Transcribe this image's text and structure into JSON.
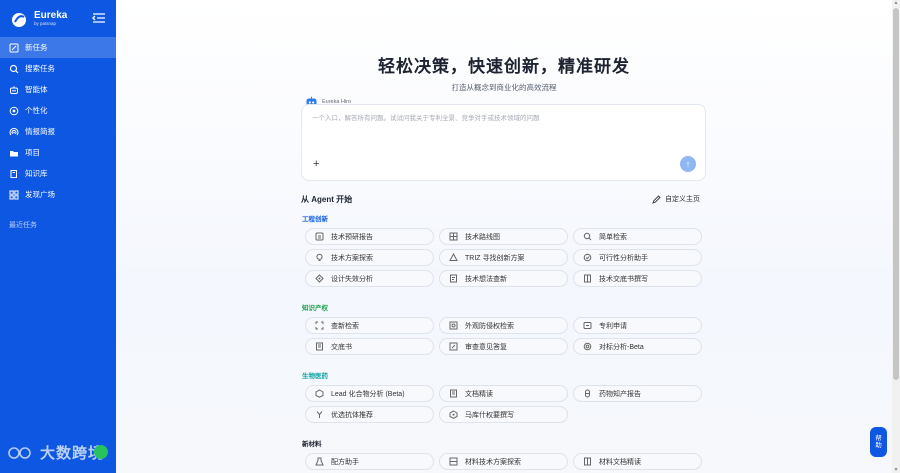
{
  "brand": {
    "name": "Eureka",
    "sub": "by patsnap"
  },
  "sidebar": {
    "items": [
      {
        "label": "新任务",
        "icon": "new-task-icon",
        "active": true
      },
      {
        "label": "搜索任务",
        "icon": "search-icon"
      },
      {
        "label": "智能体",
        "icon": "agent-icon"
      },
      {
        "label": "个性化",
        "icon": "personalize-icon"
      },
      {
        "label": "情报简报",
        "icon": "broadcast-icon"
      },
      {
        "label": "项目",
        "icon": "folder-icon"
      },
      {
        "label": "知识库",
        "icon": "book-icon"
      },
      {
        "label": "发现广场",
        "icon": "grid-icon"
      }
    ],
    "recent_label": "最近任务"
  },
  "watermark": {
    "text": "大数跨境"
  },
  "hero": {
    "title": "轻松决策，快速创新，精准研发",
    "subtitle": "打造从概念到商业化的高效流程"
  },
  "assistant": {
    "name": "Eureka Hiro"
  },
  "chat": {
    "placeholder": "一个入口，解答所有问题。试试问我关于专利全景、竞争对手或技术领域的问题",
    "add_label": "+",
    "send_label": "↑"
  },
  "agents": {
    "heading": "从 Agent 开始",
    "customize_label": "自定义主页",
    "sections": [
      {
        "name": "工程创新",
        "color": "#1a63e8",
        "items": [
          [
            "技术预研报告",
            "技术路线图",
            "简单检索"
          ],
          [
            "技术方案探索",
            "TRIZ 寻找创新方案",
            "可行性分析助手"
          ],
          [
            "设计失效分析",
            "技术想法查新",
            "技术交底书撰写"
          ]
        ]
      },
      {
        "name": "知识产权",
        "color": "#1aa34a",
        "items": [
          [
            "查新检索",
            "外观防侵权检索",
            "专利申请"
          ],
          [
            "交底书",
            "审查意见答复",
            "对标分析-Beta"
          ]
        ]
      },
      {
        "name": "生物医药",
        "color": "#12a3a6",
        "items": [
          [
            "Lead 化合物分析 (Beta)",
            "文档精读",
            "药物知产报告"
          ],
          [
            "优选抗体推荐",
            "马库什权要撰写"
          ]
        ]
      },
      {
        "name": "新材料",
        "color": "#1d2330",
        "items": [
          [
            "配方助手",
            "材料技术方案探索",
            "材料文档精读"
          ]
        ]
      }
    ]
  },
  "helper": {
    "line1": "帮",
    "line2": "助"
  },
  "colors": {
    "sidebar": "#0d57e3",
    "accent": "#1a63e8",
    "send_button": "#8eb7f4"
  }
}
